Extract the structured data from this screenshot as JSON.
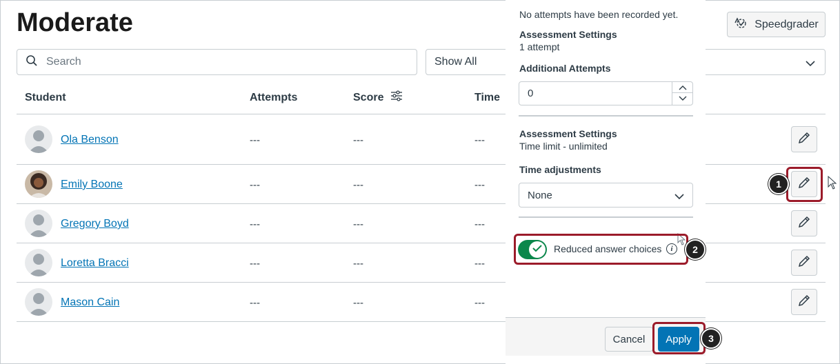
{
  "page": {
    "title": "Moderate"
  },
  "toolbar": {
    "speedgrader_label": "Speedgrader"
  },
  "search": {
    "placeholder": "Search"
  },
  "filter": {
    "selected": "Show All"
  },
  "table": {
    "headers": {
      "student": "Student",
      "attempts": "Attempts",
      "score": "Score",
      "time": "Time"
    },
    "rows": [
      {
        "name": "Ola Benson",
        "attempts": "---",
        "score": "---",
        "time": "---",
        "avatar": "default"
      },
      {
        "name": "Emily Boone",
        "attempts": "---",
        "score": "---",
        "time": "---",
        "avatar": "photo"
      },
      {
        "name": "Gregory Boyd",
        "attempts": "---",
        "score": "---",
        "time": "---",
        "avatar": "default"
      },
      {
        "name": "Loretta Bracci",
        "attempts": "---",
        "score": "---",
        "time": "---",
        "avatar": "default"
      },
      {
        "name": "Mason Cain",
        "attempts": "---",
        "score": "---",
        "time": "---",
        "avatar": "default"
      }
    ]
  },
  "tray": {
    "no_attempts": "No attempts have been recorded yet.",
    "attempts_settings_title": "Assessment Settings",
    "attempts_settings_value": "1 attempt",
    "additional_attempts_label": "Additional Attempts",
    "additional_attempts_value": "0",
    "time_settings_title": "Assessment Settings",
    "time_settings_value": "Time limit - unlimited",
    "time_adjustments_label": "Time adjustments",
    "time_adjustments_value": "None",
    "reduced_choices_label": "Reduced answer choices",
    "reduced_choices_on": true,
    "cancel_label": "Cancel",
    "apply_label": "Apply"
  },
  "callouts": [
    "1",
    "2",
    "3"
  ],
  "colors": {
    "link": "#0374b5",
    "apply": "#0374b5",
    "toggle_on": "#0b874b",
    "highlight": "#9b1b2a",
    "border": "#c7cdd1"
  },
  "icons": [
    "search-icon",
    "chevron-down-icon",
    "speedgrader-icon",
    "filter-sliders-icon",
    "pencil-icon",
    "checkmark-icon",
    "info-icon",
    "mouse-cursor-icon"
  ]
}
